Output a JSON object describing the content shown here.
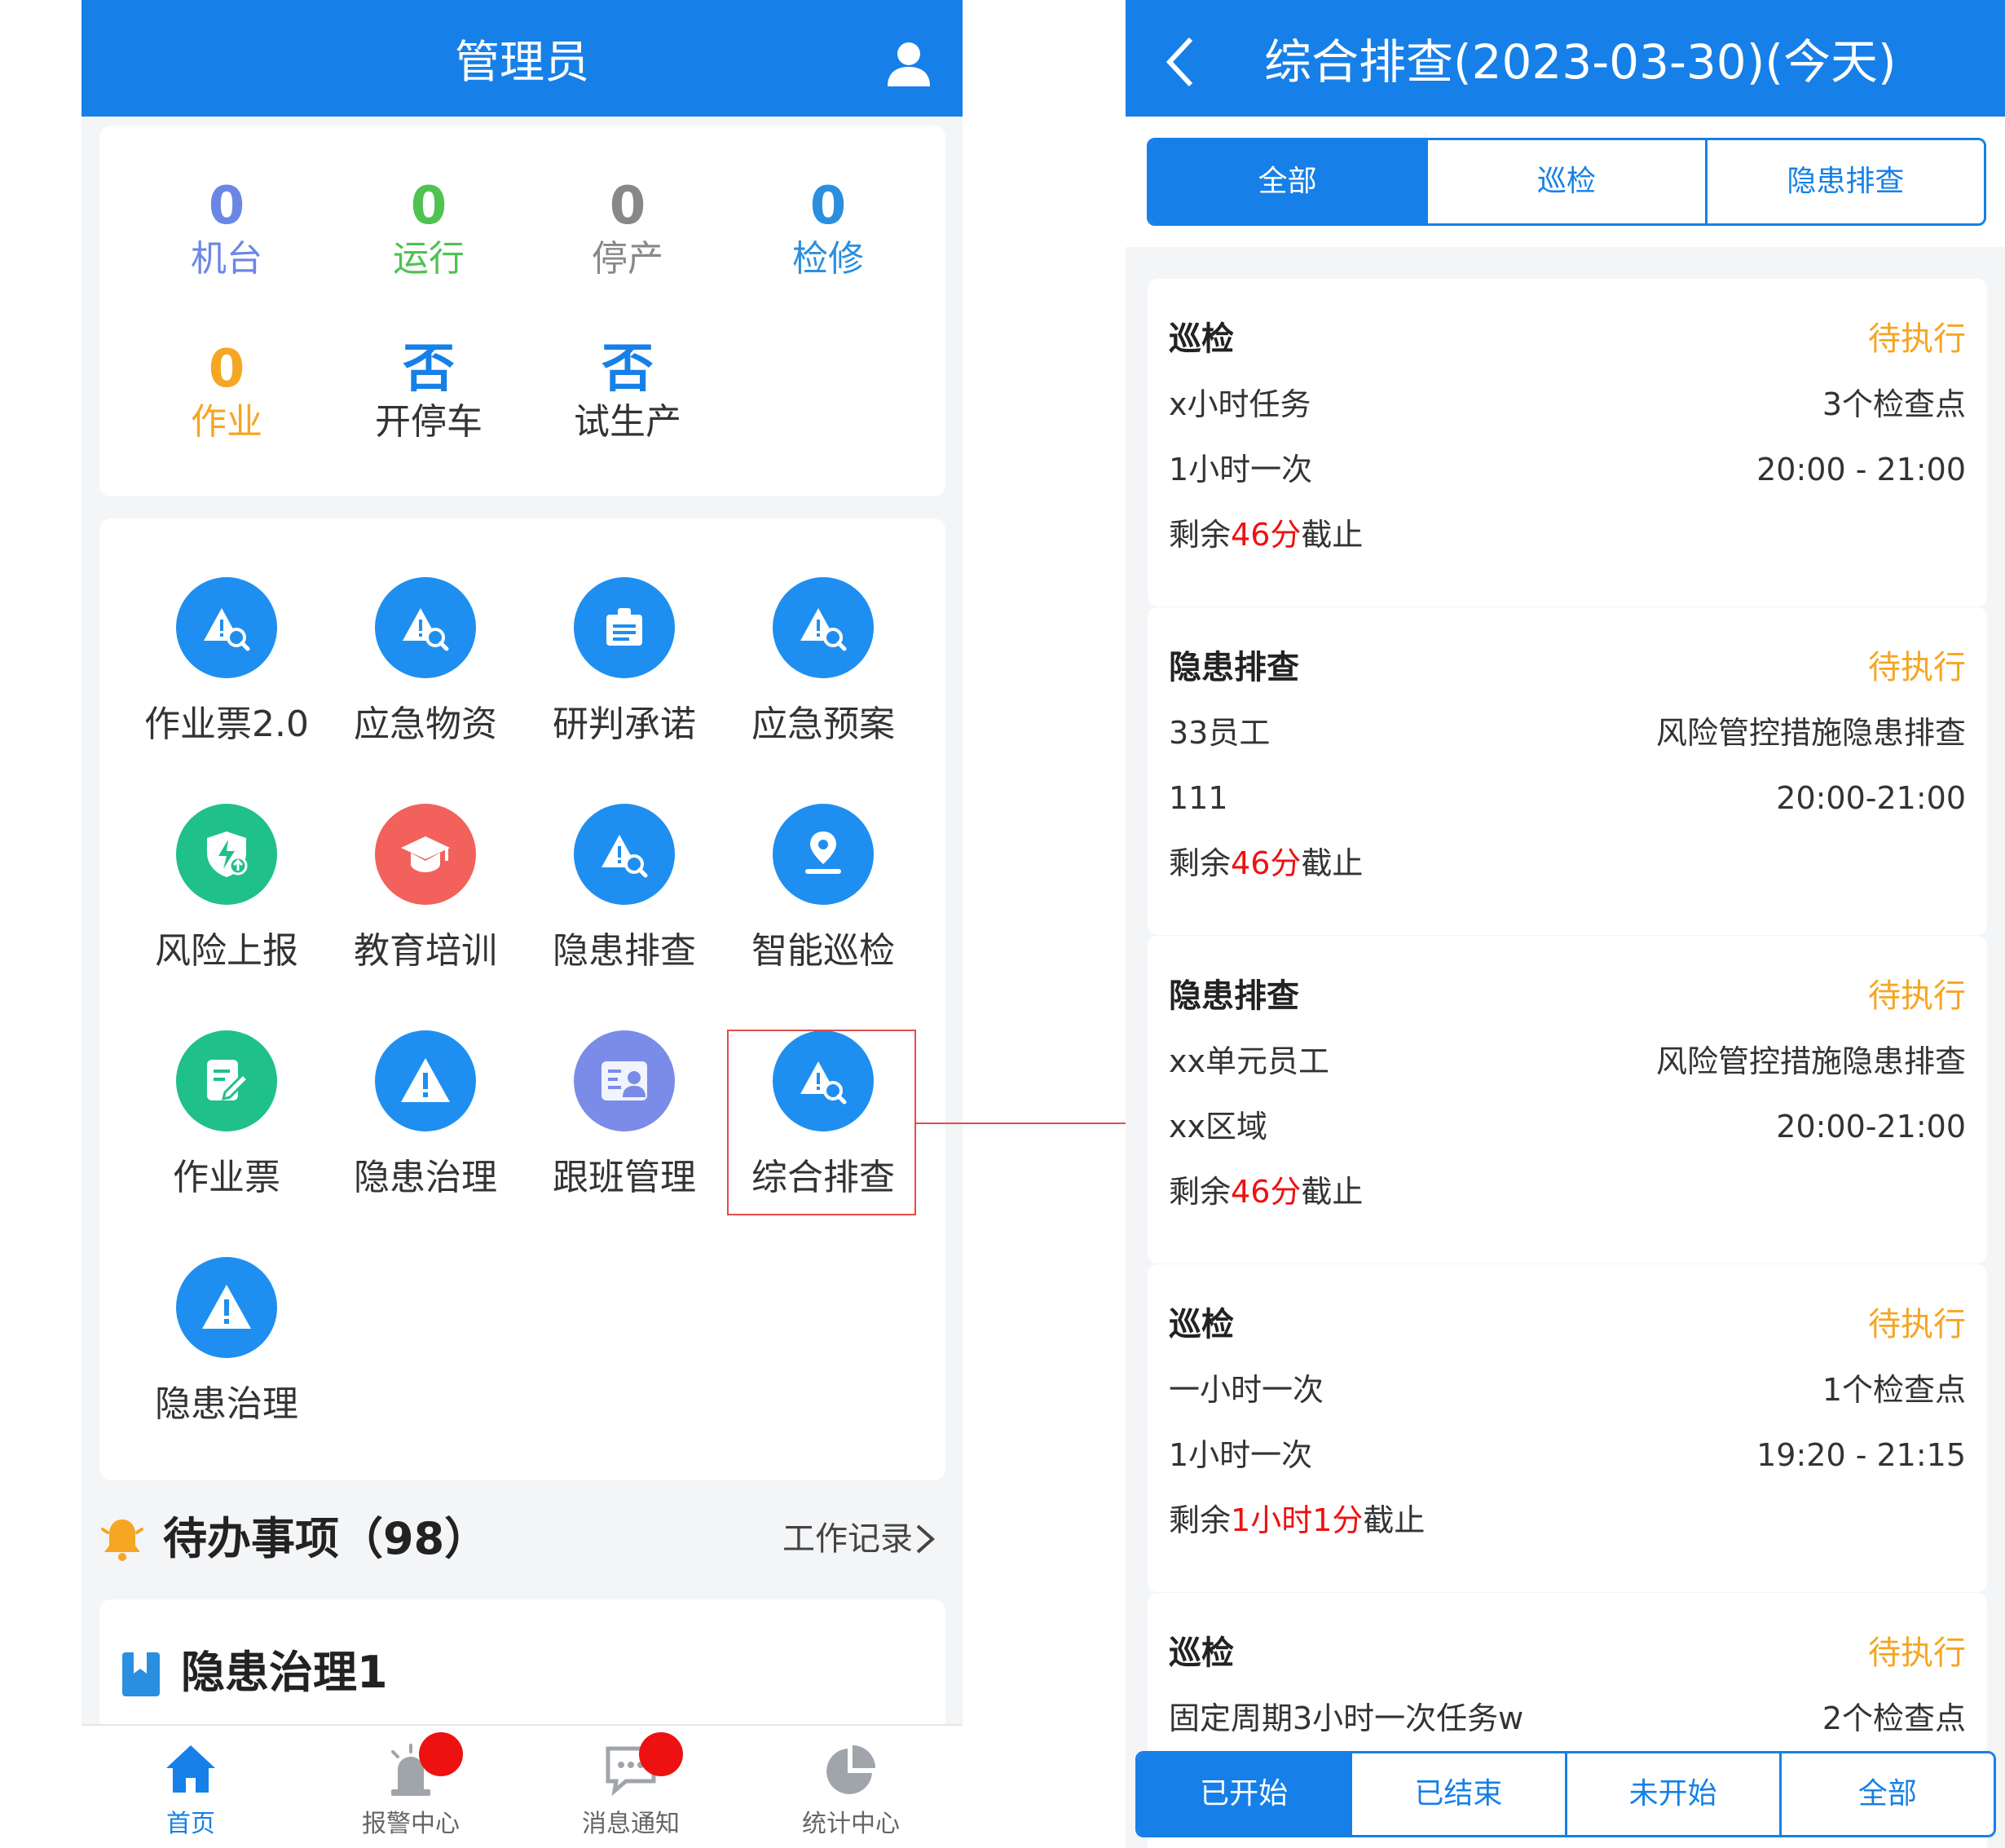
{
  "left": {
    "header": {
      "title": "管理员",
      "user_icon": "user-icon"
    },
    "stats": [
      {
        "value": "0",
        "label": "机台",
        "color": "#6b86e6"
      },
      {
        "value": "0",
        "label": "运行",
        "color": "#4fc24f"
      },
      {
        "value": "0",
        "label": "停产",
        "color": "#888888"
      },
      {
        "value": "0",
        "label": "检修",
        "color": "#2a8fdf"
      },
      {
        "value": "0",
        "label": "作业",
        "color": "#f5a623"
      },
      {
        "value": "否",
        "label": "开停车",
        "color": "#1680e8",
        "label_color": "#333333"
      },
      {
        "value": "否",
        "label": "试生产",
        "color": "#1680e8",
        "label_color": "#333333"
      }
    ],
    "apps": [
      {
        "label": "作业票2.0",
        "icon": "warning-search-icon",
        "color": "#1e8ff0"
      },
      {
        "label": "应急物资",
        "icon": "warning-search-icon",
        "color": "#1e8ff0"
      },
      {
        "label": "研判承诺",
        "icon": "clipboard-icon",
        "color": "#1e8ff0"
      },
      {
        "label": "应急预案",
        "icon": "warning-search-icon",
        "color": "#1e8ff0"
      },
      {
        "label": "风险上报",
        "icon": "shield-upload-icon",
        "color": "#1fc08a"
      },
      {
        "label": "教育培训",
        "icon": "graduation-cap-icon",
        "color": "#f2615c"
      },
      {
        "label": "隐患排查",
        "icon": "warning-search-icon",
        "color": "#1e8ff0"
      },
      {
        "label": "智能巡检",
        "icon": "location-pin-icon",
        "color": "#1e8ff0"
      },
      {
        "label": "作业票",
        "icon": "edit-note-icon",
        "color": "#1fc08a"
      },
      {
        "label": "隐患治理",
        "icon": "warning-icon",
        "color": "#1e8ff0"
      },
      {
        "label": "跟班管理",
        "icon": "id-card-icon",
        "color": "#7b8be8"
      },
      {
        "label": "综合排查",
        "icon": "warning-search-icon",
        "color": "#1e8ff0"
      },
      {
        "label": "隐患治理",
        "icon": "warning-icon",
        "color": "#1e8ff0"
      }
    ],
    "todo": {
      "title": "待办事项（98）",
      "link": "工作记录",
      "icon": "bell-icon"
    },
    "todo_item": {
      "title": "隐患治理1",
      "icon": "bookmark-icon"
    },
    "tabs": [
      {
        "label": "首页",
        "icon": "home-icon",
        "active": true,
        "badge": false
      },
      {
        "label": "报警中心",
        "icon": "alarm-light-icon",
        "active": false,
        "badge": true
      },
      {
        "label": "消息通知",
        "icon": "chat-icon",
        "active": false,
        "badge": true
      },
      {
        "label": "统计中心",
        "icon": "pie-chart-icon",
        "active": false,
        "badge": false
      }
    ]
  },
  "right": {
    "header": {
      "title": "综合排查(2023-03-30)(今天)",
      "back_icon": "chevron-left-icon"
    },
    "filter_tabs": [
      {
        "label": "全部",
        "active": true
      },
      {
        "label": "巡检",
        "active": false
      },
      {
        "label": "隐患排查",
        "active": false
      }
    ],
    "tasks": [
      {
        "type": "巡检",
        "status": "待执行",
        "name": "x小时任务",
        "points": "3个检查点",
        "freq": "1小时一次",
        "time": "20:00 - 21:00",
        "remain_pre": "剩余",
        "remain": "46分",
        "remain_post": "截止"
      },
      {
        "type": "隐患排查",
        "status": "待执行",
        "name": "33员工",
        "points": "风险管控措施隐患排查",
        "freq": "111",
        "time": "20:00-21:00",
        "remain_pre": "剩余",
        "remain": "46分",
        "remain_post": "截止"
      },
      {
        "type": "隐患排查",
        "status": "待执行",
        "name": "xx单元员工",
        "points": "风险管控措施隐患排查",
        "freq": "xx区域",
        "time": "20:00-21:00",
        "remain_pre": "剩余",
        "remain": "46分",
        "remain_post": "截止"
      },
      {
        "type": "巡检",
        "status": "待执行",
        "name": "一小时一次",
        "points": "1个检查点",
        "freq": "1小时一次",
        "time": "19:20 - 21:15",
        "remain_pre": "剩余",
        "remain": "1小时1分",
        "remain_post": "截止"
      },
      {
        "type": "巡检",
        "status": "待执行",
        "name": "固定周期3小时一次任务w",
        "points": "2个检查点",
        "freq": "",
        "time": "",
        "remain_pre": "",
        "remain": "",
        "remain_post": ""
      }
    ],
    "state_tabs": [
      {
        "label": "已开始",
        "active": true
      },
      {
        "label": "已结束",
        "active": false
      },
      {
        "label": "未开始",
        "active": false
      },
      {
        "label": "全部",
        "active": false
      }
    ]
  }
}
